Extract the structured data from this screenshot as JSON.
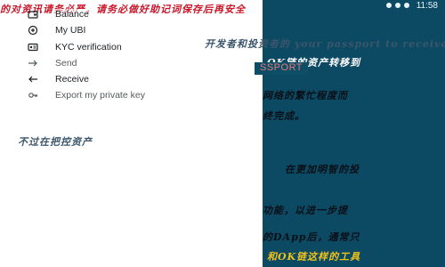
{
  "status_bar": {
    "time": "11:58"
  },
  "menu": {
    "items": [
      {
        "label": "Balance",
        "icon": "wallet-icon"
      },
      {
        "label": "My UBI",
        "icon": "ubi-icon"
      },
      {
        "label": "KYC verification",
        "icon": "id-card-icon"
      },
      {
        "label": "Send",
        "icon": "send-icon"
      },
      {
        "label": "Receive",
        "icon": "receive-icon"
      },
      {
        "label": "Export my private key",
        "icon": "key-icon"
      }
    ]
  },
  "overlay": {
    "passport_text": "SSPORT",
    "lines": [
      "的对资讯请务必严，请务必做好助记词保存后再安全",
      "开发者和投资者的 your passport to receive",
      "OK链的资产转移到",
      "网络的繁忙程度而",
      "终完成。",
      "不过在把控资产",
      "在更加明智的投",
      "功能，以进一步提",
      "的DApp后，通常只",
      "和OK链这样的工具"
    ]
  },
  "colors": {
    "panel_right": "#0c4a63",
    "panel_left": "#ffffff",
    "accent_red": "#c8182a",
    "accent_yellow": "#f2c21a"
  }
}
